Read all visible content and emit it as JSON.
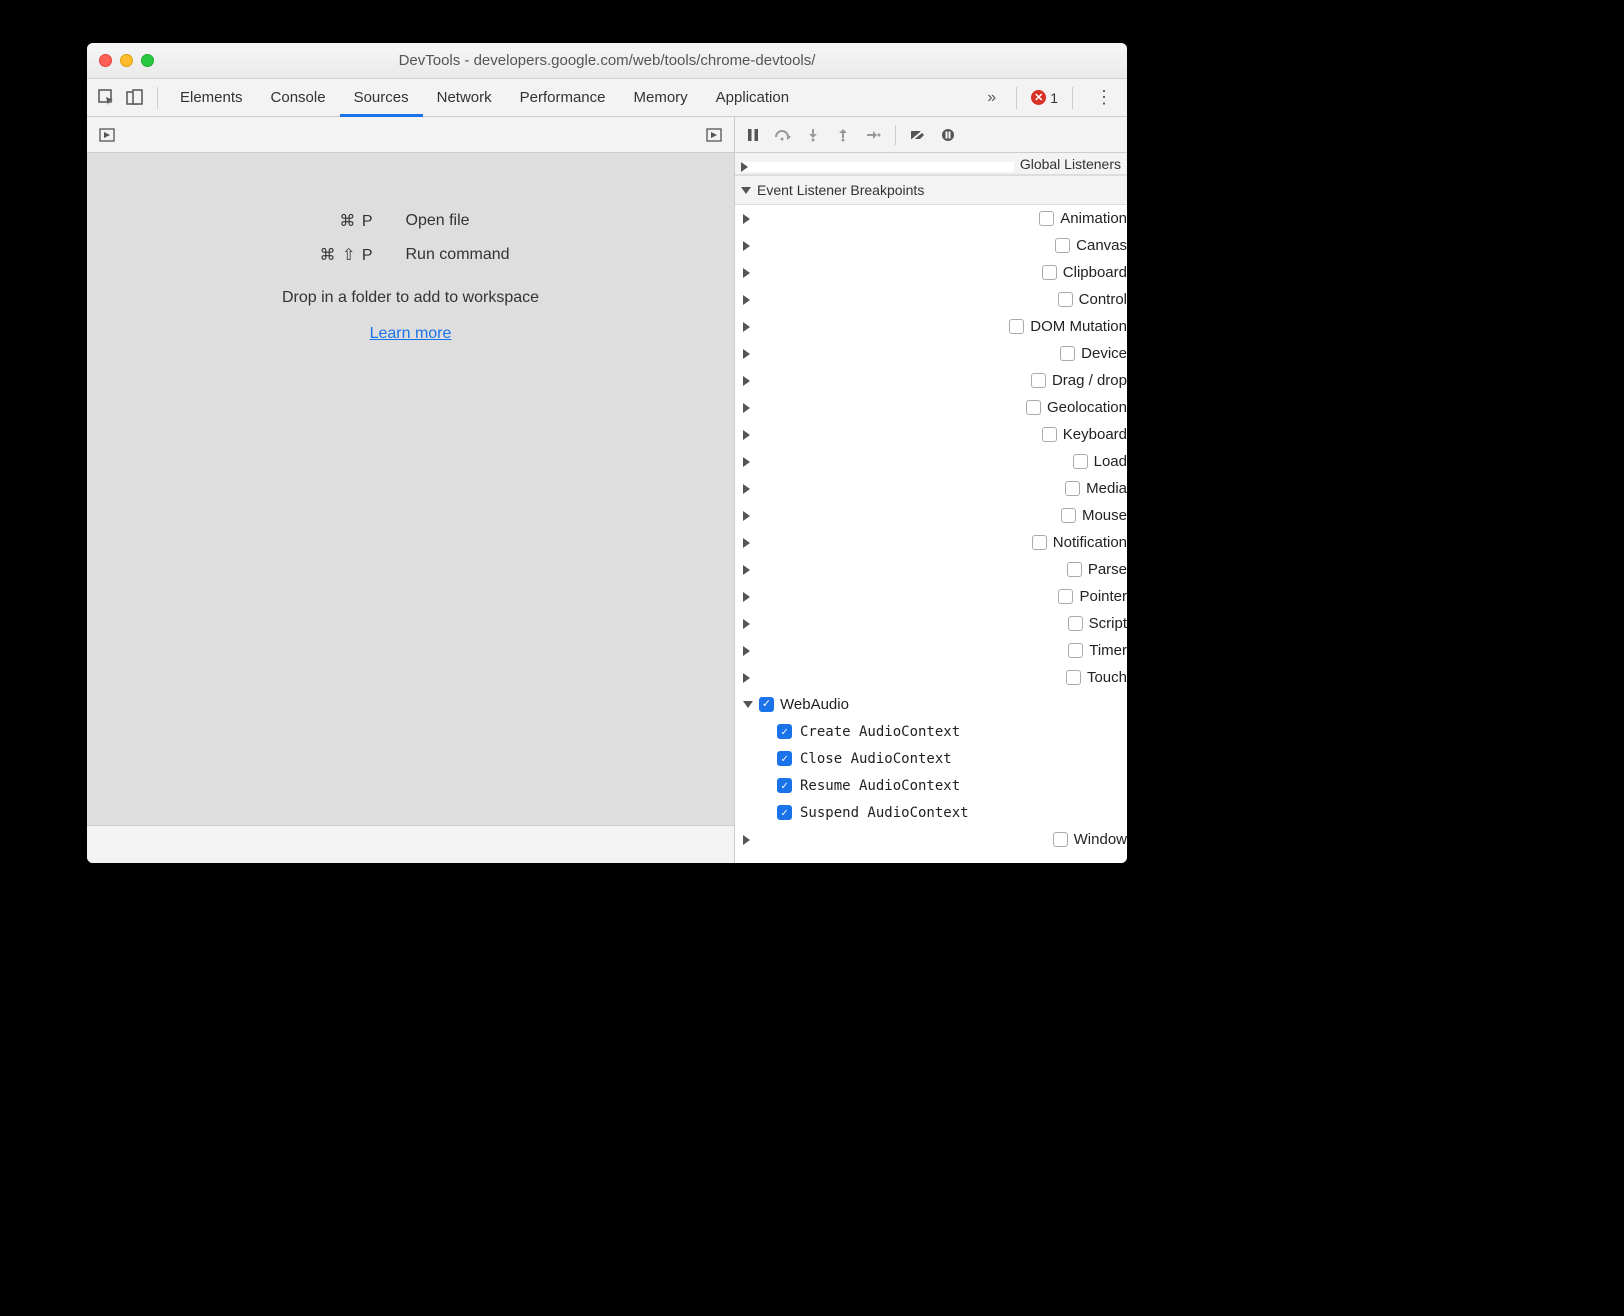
{
  "window": {
    "title": "DevTools - developers.google.com/web/tools/chrome-devtools/"
  },
  "tabbar": {
    "tabs": [
      "Elements",
      "Console",
      "Sources",
      "Network",
      "Performance",
      "Memory",
      "Application"
    ],
    "active": "Sources",
    "error_count": "1"
  },
  "sources_empty": {
    "shortcut_open_keys": "⌘ P",
    "shortcut_open_label": "Open file",
    "shortcut_cmd_keys": "⌘ ⇧ P",
    "shortcut_cmd_label": "Run command",
    "drop_hint": "Drop in a folder to add to workspace",
    "learn_more": "Learn more"
  },
  "sidebar": {
    "global_listeners": "Global Listeners",
    "event_bp_title": "Event Listener Breakpoints",
    "categories": [
      {
        "label": "Animation",
        "expanded": false,
        "checked": false
      },
      {
        "label": "Canvas",
        "expanded": false,
        "checked": false
      },
      {
        "label": "Clipboard",
        "expanded": false,
        "checked": false
      },
      {
        "label": "Control",
        "expanded": false,
        "checked": false
      },
      {
        "label": "DOM Mutation",
        "expanded": false,
        "checked": false
      },
      {
        "label": "Device",
        "expanded": false,
        "checked": false
      },
      {
        "label": "Drag / drop",
        "expanded": false,
        "checked": false
      },
      {
        "label": "Geolocation",
        "expanded": false,
        "checked": false
      },
      {
        "label": "Keyboard",
        "expanded": false,
        "checked": false
      },
      {
        "label": "Load",
        "expanded": false,
        "checked": false
      },
      {
        "label": "Media",
        "expanded": false,
        "checked": false
      },
      {
        "label": "Mouse",
        "expanded": false,
        "checked": false
      },
      {
        "label": "Notification",
        "expanded": false,
        "checked": false
      },
      {
        "label": "Parse",
        "expanded": false,
        "checked": false
      },
      {
        "label": "Pointer",
        "expanded": false,
        "checked": false
      },
      {
        "label": "Script",
        "expanded": false,
        "checked": false
      },
      {
        "label": "Timer",
        "expanded": false,
        "checked": false
      },
      {
        "label": "Touch",
        "expanded": false,
        "checked": false
      },
      {
        "label": "WebAudio",
        "expanded": true,
        "checked": true,
        "children": [
          {
            "label": "Create AudioContext",
            "checked": true
          },
          {
            "label": "Close AudioContext",
            "checked": true
          },
          {
            "label": "Resume AudioContext",
            "checked": true
          },
          {
            "label": "Suspend AudioContext",
            "checked": true
          }
        ]
      },
      {
        "label": "Window",
        "expanded": false,
        "checked": false
      }
    ]
  }
}
